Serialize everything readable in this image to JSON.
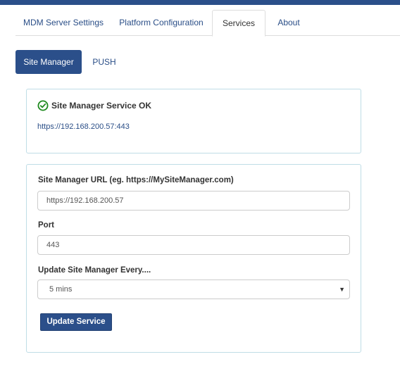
{
  "tabs": {
    "mdm": "MDM Server Settings",
    "platform": "Platform Configuration",
    "services": "Services",
    "about": "About"
  },
  "pills": {
    "site_manager": "Site Manager",
    "push": "PUSH"
  },
  "status": {
    "icon": "check-circle-icon",
    "text": "Site Manager Service OK",
    "url": "https://192.168.200.57:443",
    "ok_color": "#1e8a1e"
  },
  "form": {
    "url_label": "Site Manager URL (eg. https://MySiteManager.com)",
    "url_value": "https://192.168.200.57",
    "port_label": "Port",
    "port_value": "443",
    "update_label": "Update Site Manager Every....",
    "update_value": "5 mins",
    "submit_label": "Update Service"
  },
  "colors": {
    "primary": "#2b4f8a",
    "link": "#2a4e87",
    "panel_border": "#bfdde6"
  }
}
